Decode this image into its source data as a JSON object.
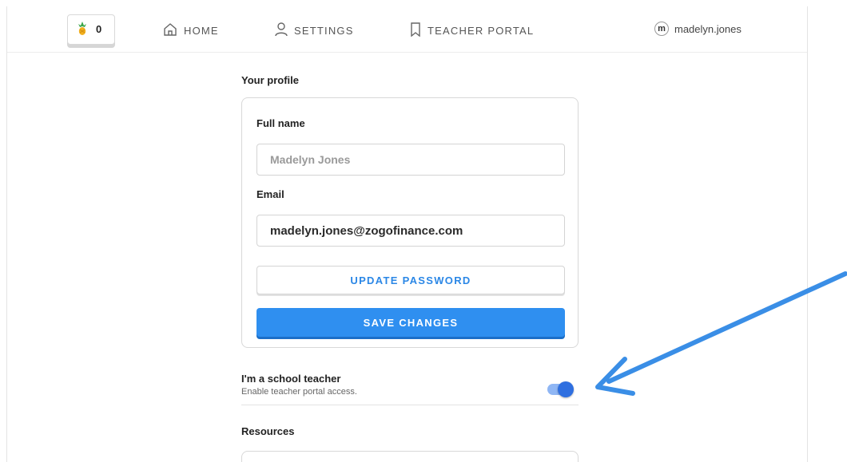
{
  "navbar": {
    "pineapple_count": "0",
    "home_label": "HOME",
    "settings_label": "SETTINGS",
    "teacher_portal_label": "TEACHER PORTAL",
    "user_initial": "m",
    "username": "madelyn.jones"
  },
  "profile": {
    "section_title": "Your profile",
    "full_name_label": "Full name",
    "full_name_placeholder": "Madelyn Jones",
    "email_label": "Email",
    "email_value": "madelyn.jones@zogofinance.com",
    "update_password_label": "UPDATE PASSWORD",
    "save_changes_label": "SAVE CHANGES"
  },
  "teacher_toggle": {
    "title": "I'm a school teacher",
    "description": "Enable teacher portal access.",
    "enabled": true
  },
  "resources": {
    "section_title": "Resources"
  },
  "colors": {
    "accent_blue": "#2f8ff0",
    "annotation_arrow": "#3a8ee6"
  }
}
